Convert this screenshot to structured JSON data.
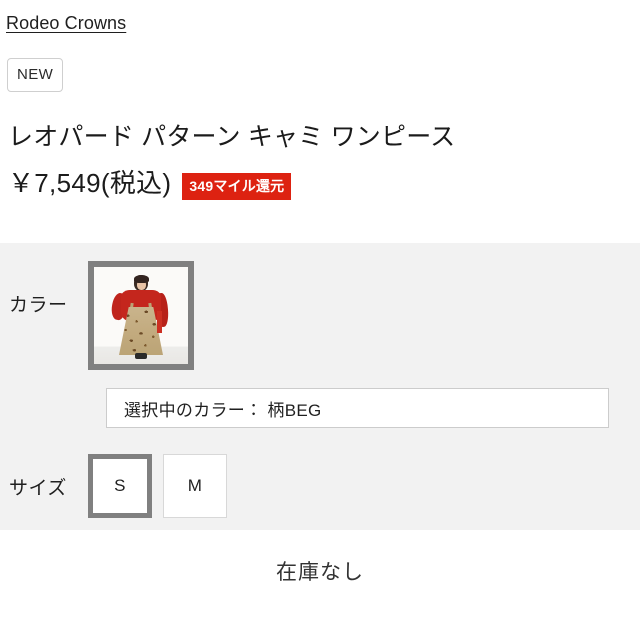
{
  "brand": {
    "name": "Rodeo Crowns"
  },
  "badges": {
    "new_label": "NEW"
  },
  "product": {
    "title": "レオパード パターン キャミ ワンピース",
    "price": "￥7,549(税込)",
    "mile_badge": "349マイル還元",
    "mile_badge_color": "#dd2211"
  },
  "options": {
    "color": {
      "label": "カラー",
      "swatches": [
        {
          "name": "柄BEG",
          "selected": true
        }
      ],
      "selected_display": "選択中のカラー： 柄BEG"
    },
    "size": {
      "label": "サイズ",
      "items": [
        {
          "label": "S",
          "selected": true
        },
        {
          "label": "M",
          "selected": false
        }
      ]
    }
  },
  "stock": {
    "status": "在庫なし"
  }
}
